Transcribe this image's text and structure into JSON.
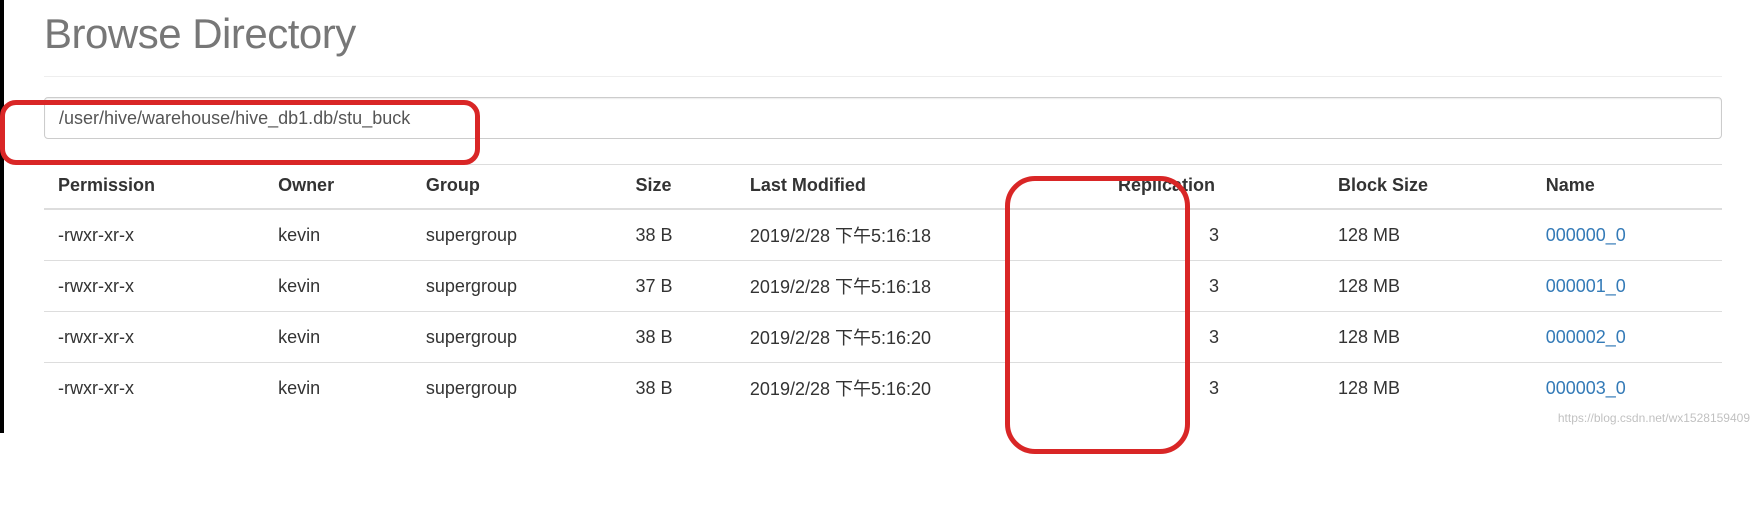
{
  "header": {
    "title": "Browse Directory"
  },
  "path": {
    "value": "/user/hive/warehouse/hive_db1.db/stu_buck"
  },
  "table": {
    "headers": {
      "permission": "Permission",
      "owner": "Owner",
      "group": "Group",
      "size": "Size",
      "last_modified": "Last Modified",
      "replication": "Replication",
      "block_size": "Block Size",
      "name": "Name"
    },
    "rows": [
      {
        "permission": "-rwxr-xr-x",
        "owner": "kevin",
        "group": "supergroup",
        "size": "38 B",
        "last_modified": "2019/2/28 下午5:16:18",
        "replication": "3",
        "block_size": "128 MB",
        "name": "000000_0"
      },
      {
        "permission": "-rwxr-xr-x",
        "owner": "kevin",
        "group": "supergroup",
        "size": "37 B",
        "last_modified": "2019/2/28 下午5:16:18",
        "replication": "3",
        "block_size": "128 MB",
        "name": "000001_0"
      },
      {
        "permission": "-rwxr-xr-x",
        "owner": "kevin",
        "group": "supergroup",
        "size": "38 B",
        "last_modified": "2019/2/28 下午5:16:20",
        "replication": "3",
        "block_size": "128 MB",
        "name": "000002_0"
      },
      {
        "permission": "-rwxr-xr-x",
        "owner": "kevin",
        "group": "supergroup",
        "size": "38 B",
        "last_modified": "2019/2/28 下午5:16:20",
        "replication": "3",
        "block_size": "128 MB",
        "name": "000003_0"
      }
    ]
  },
  "watermark": "https://blog.csdn.net/wx1528159409"
}
